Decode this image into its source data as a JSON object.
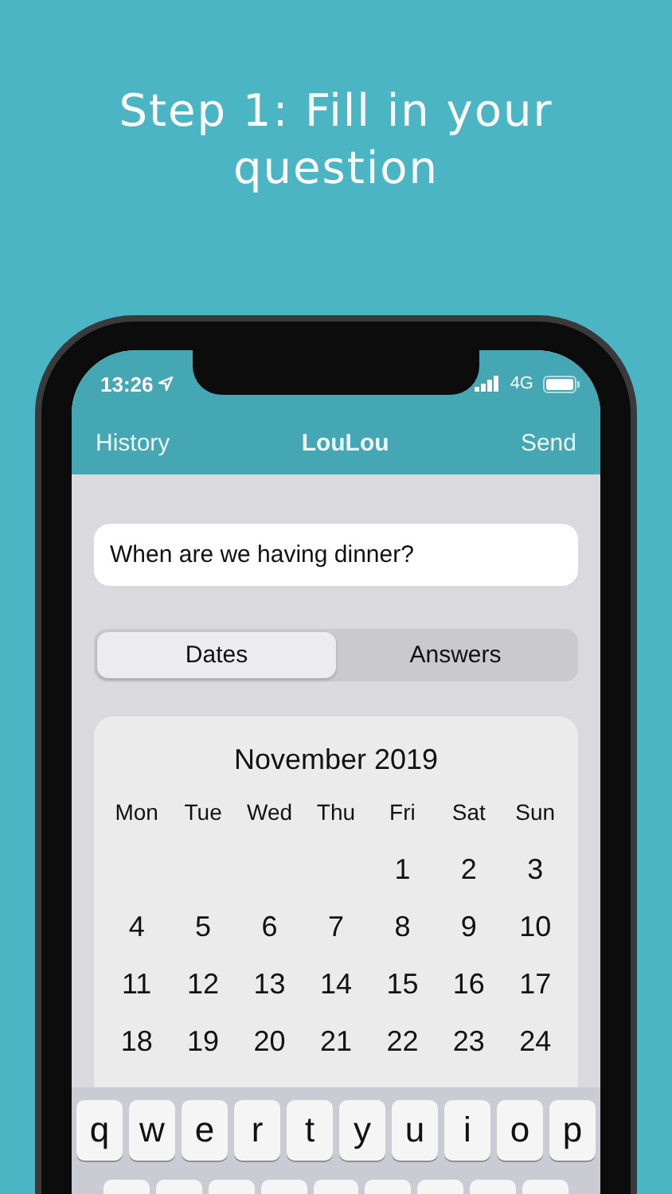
{
  "headline": "Step 1: Fill in your question",
  "status_bar": {
    "time": "13:26",
    "network": "4G"
  },
  "nav_bar": {
    "left": "History",
    "title": "LouLou",
    "right": "Send"
  },
  "question_field": {
    "value": "When are we having dinner?"
  },
  "segments": [
    {
      "label": "Dates",
      "selected": true
    },
    {
      "label": "Answers",
      "selected": false
    }
  ],
  "calendar": {
    "month": "November 2019",
    "weekdays": [
      "Mon",
      "Tue",
      "Wed",
      "Thu",
      "Fri",
      "Sat",
      "Sun"
    ],
    "weeks": [
      {
        "kind": "partial",
        "days": [
          "1",
          "2",
          "3"
        ]
      },
      {
        "kind": "full",
        "days": [
          "4",
          "5",
          "6",
          "7",
          "8",
          "9",
          "10"
        ]
      },
      {
        "kind": "full",
        "days": [
          "11",
          "12",
          "13",
          "14",
          "15",
          "16",
          "17"
        ]
      },
      {
        "kind": "full",
        "days": [
          "18",
          "19",
          "20",
          "21",
          "22",
          "23",
          "24"
        ]
      }
    ]
  },
  "keyboard": {
    "keys": [
      "q",
      "w",
      "e",
      "r",
      "t",
      "y",
      "u",
      "i",
      "o",
      "p"
    ]
  }
}
